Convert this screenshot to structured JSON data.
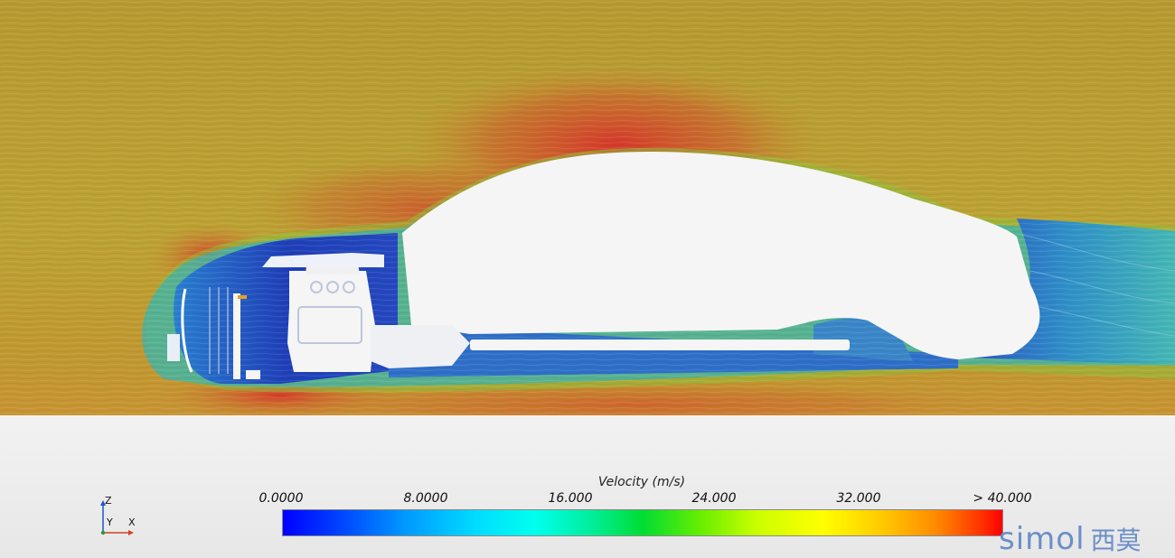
{
  "legend": {
    "title": "Velocity (m/s)",
    "ticks": [
      "0.0000",
      "8.0000",
      "16.000",
      "24.000",
      "32.000",
      "> 40.000"
    ]
  },
  "axes": {
    "z": "Z",
    "y": "Y",
    "x": "X"
  },
  "brand": {
    "latin": "simol",
    "cjk": "西莫"
  },
  "colors": {
    "freestream": "#b4962c",
    "high_velocity": "#d23a25",
    "low_velocity": "#2035b8",
    "body_fill": "#f5f5f5"
  },
  "icons": [
    "axis-triad-icon",
    "brand-logo"
  ]
}
